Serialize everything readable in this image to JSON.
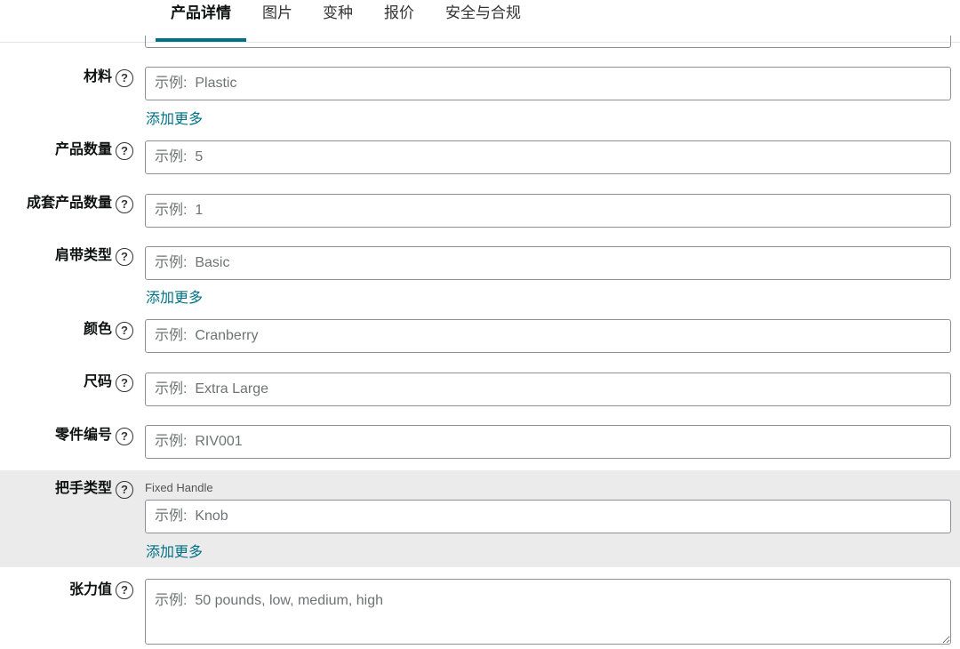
{
  "tabs": [
    {
      "label": "产品详情",
      "active": true
    },
    {
      "label": "图片"
    },
    {
      "label": "变种"
    },
    {
      "label": "报价"
    },
    {
      "label": "安全与合规"
    }
  ],
  "help_glyph": "?",
  "add_more_label": "添加更多",
  "fields": {
    "material": {
      "label": "材料",
      "placeholder": "示例:  Plastic"
    },
    "item_count": {
      "label": "产品数量",
      "placeholder": "示例:  5"
    },
    "set_count": {
      "label": "成套产品数量",
      "placeholder": "示例:  1"
    },
    "strap_type": {
      "label": "肩带类型",
      "placeholder": "示例:  Basic"
    },
    "color": {
      "label": "颜色",
      "placeholder": "示例:  Cranberry"
    },
    "size": {
      "label": "尺码",
      "placeholder": "示例:  Extra Large"
    },
    "part_number": {
      "label": "零件编号",
      "placeholder": "示例:  RIV001"
    },
    "handle_type": {
      "label": "把手类型",
      "hint": "Fixed Handle",
      "placeholder": "示例:  Knob"
    },
    "tension": {
      "label": "张力值",
      "placeholder": "示例:  50 pounds, low, medium, high"
    }
  },
  "colors": {
    "accent": "#007185",
    "highlight_bg": "#ebebeb",
    "border": "#8d9096"
  }
}
